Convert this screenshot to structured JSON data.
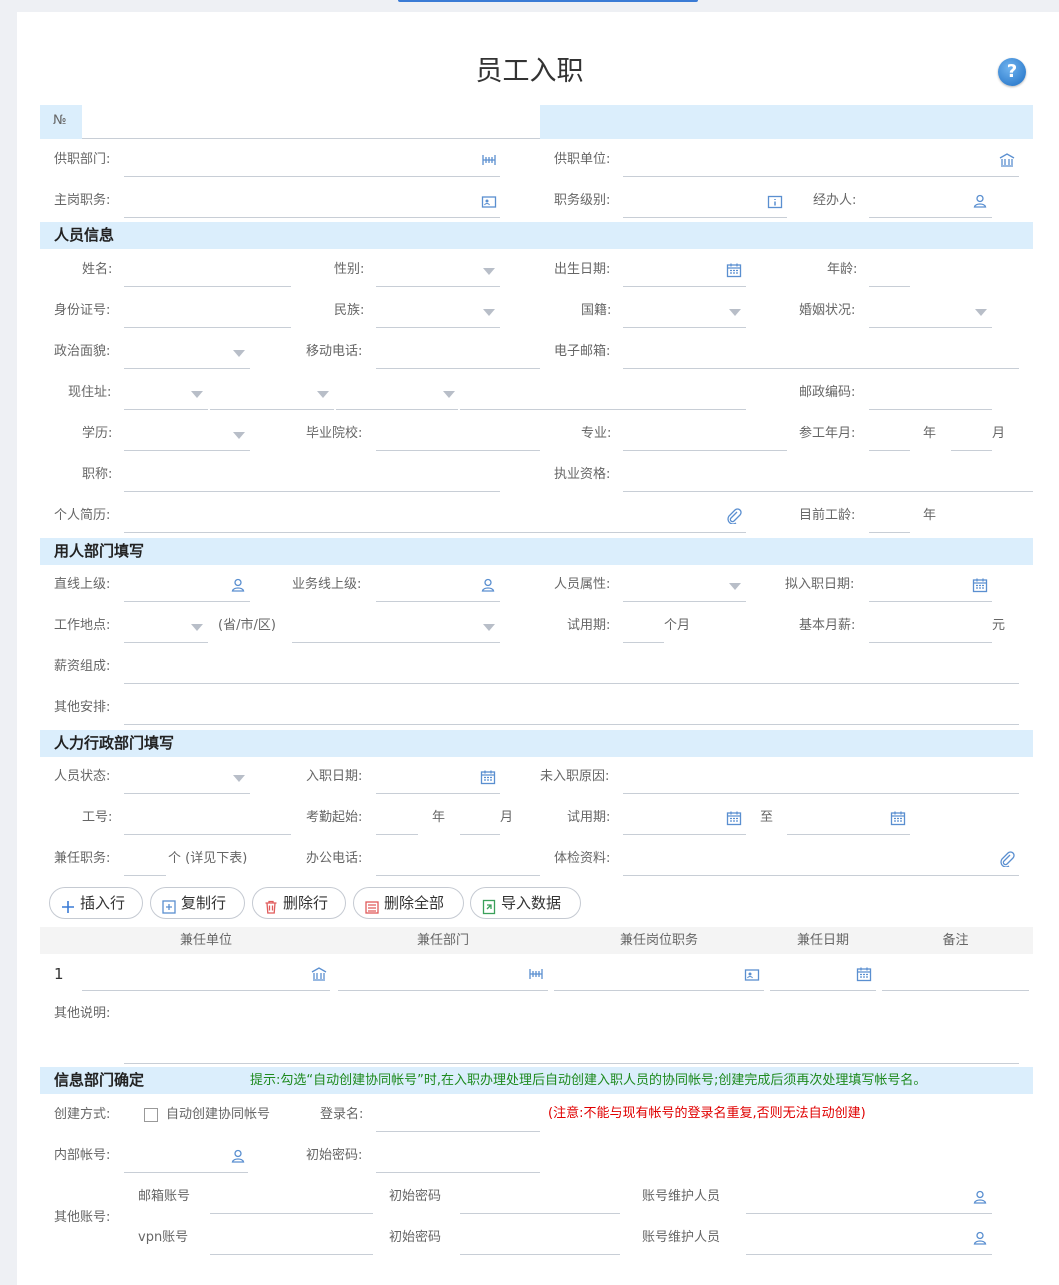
{
  "form": {
    "title": "员工入职",
    "help": "?",
    "number_label": "№"
  },
  "header_fields": {
    "dept": "供职部门:",
    "unit": "供职单位:",
    "position": "主岗职务:",
    "level": "职务级别:",
    "handler": "经办人:"
  },
  "sections": {
    "personal": "人员信息",
    "employer": "用人部门填写",
    "hr": "人力行政部门填写",
    "it": "信息部门确定"
  },
  "personal": {
    "name": "姓名:",
    "gender": "性别:",
    "birth": "出生日期:",
    "age": "年龄:",
    "id_no": "身份证号:",
    "ethnicity": "民族:",
    "nationality": "国籍:",
    "marital": "婚姻状况:",
    "political": "政治面貌:",
    "mobile": "移动电话:",
    "email": "电子邮箱:",
    "address": "现住址:",
    "postal": "邮政编码:",
    "education": "学历:",
    "school": "毕业院校:",
    "major": "专业:",
    "work_start": "参工年月:",
    "year": "年",
    "month": "月",
    "title": "职称:",
    "qualification": "执业资格:",
    "resume": "个人简历:",
    "seniority": "目前工龄:",
    "seniority_unit": "年"
  },
  "employer": {
    "direct_sup": "直线上级:",
    "biz_sup": "业务线上级:",
    "attr": "人员属性:",
    "plan_date": "拟入职日期:",
    "location": "工作地点:",
    "loc_hint": "(省/市/区)",
    "probation": "试用期:",
    "prob_unit": "个月",
    "salary": "基本月薪:",
    "salary_unit": "元",
    "salary_comp": "薪资组成:",
    "other": "其他安排:"
  },
  "hr": {
    "status": "人员状态:",
    "entry_date": "入职日期:",
    "no_entry": "未入职原因:",
    "emp_no": "工号:",
    "attendance": "考勤起始:",
    "year": "年",
    "month": "月",
    "probation": "试用期:",
    "to": "至",
    "concurrent": "兼任职务:",
    "concurrent_hint": "个 (详见下表)",
    "office_phone": "办公电话:",
    "medical": "体检资料:"
  },
  "toolbar": {
    "insert": "插入行",
    "copy": "复制行",
    "delete": "删除行",
    "delete_all": "删除全部",
    "import": "导入数据"
  },
  "table": {
    "headers": [
      "兼任单位",
      "兼任部门",
      "兼任岗位职务",
      "兼任日期",
      "备注"
    ],
    "row_index": "1",
    "other_note": "其他说明:"
  },
  "it": {
    "hint": "提示:勾选“自动创建协同帐号”时,在入职办理处理后自动创建入职人员的协同帐号;创建完成后须再次处理填写帐号名。",
    "create_mode": "创建方式:",
    "auto_create": "自动创建协同帐号",
    "login": "登录名:",
    "warning": "(注意:不能与现有帐号的登录名重复,否则无法自动创建)",
    "inner_acct": "内部帐号:",
    "init_pwd": "初始密码:",
    "other_acct": "其他账号:",
    "mail_acct": "邮箱账号",
    "vpn_acct": "vpn账号",
    "pwd": "初始密码",
    "maintainer": "账号维护人员"
  },
  "colors": {
    "band": "#dbeefc",
    "accent": "#3a7bd5",
    "hint_green": "#1e8a1e",
    "warn_red": "#e00000"
  }
}
